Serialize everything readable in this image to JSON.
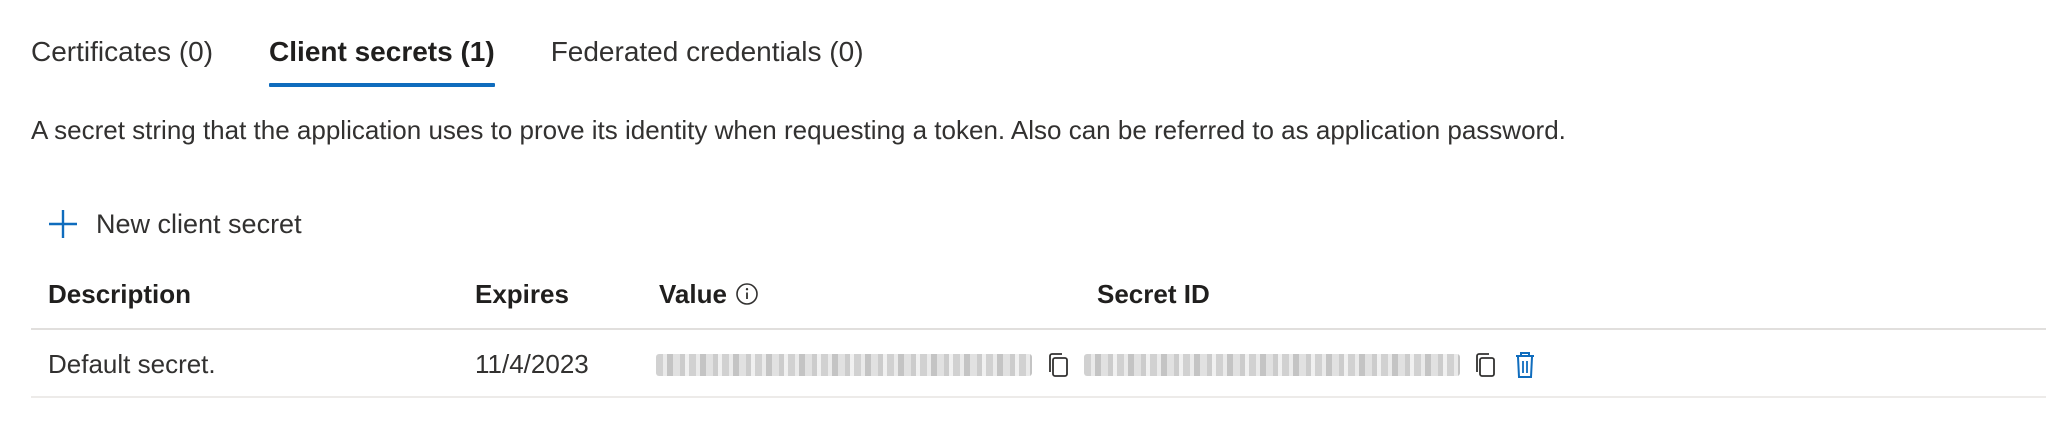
{
  "tabs": [
    {
      "label": "Certificates (0)",
      "active": false
    },
    {
      "label": "Client secrets (1)",
      "active": true
    },
    {
      "label": "Federated credentials (0)",
      "active": false
    }
  ],
  "description": "A secret string that the application uses to prove its identity when requesting a token. Also can be referred to as application password.",
  "toolbar": {
    "new_secret_label": "New client secret",
    "new_secret_icon": "plus-icon"
  },
  "table": {
    "headers": {
      "description": "Description",
      "expires": "Expires",
      "value": "Value",
      "secret_id": "Secret ID"
    },
    "rows": [
      {
        "description": "Default secret.",
        "expires": "11/4/2023"
      }
    ]
  },
  "colors": {
    "accent": "#0f6cbd",
    "text": "#323130",
    "border": "#e1dfdd",
    "delete_icon": "#0f6cbd"
  }
}
